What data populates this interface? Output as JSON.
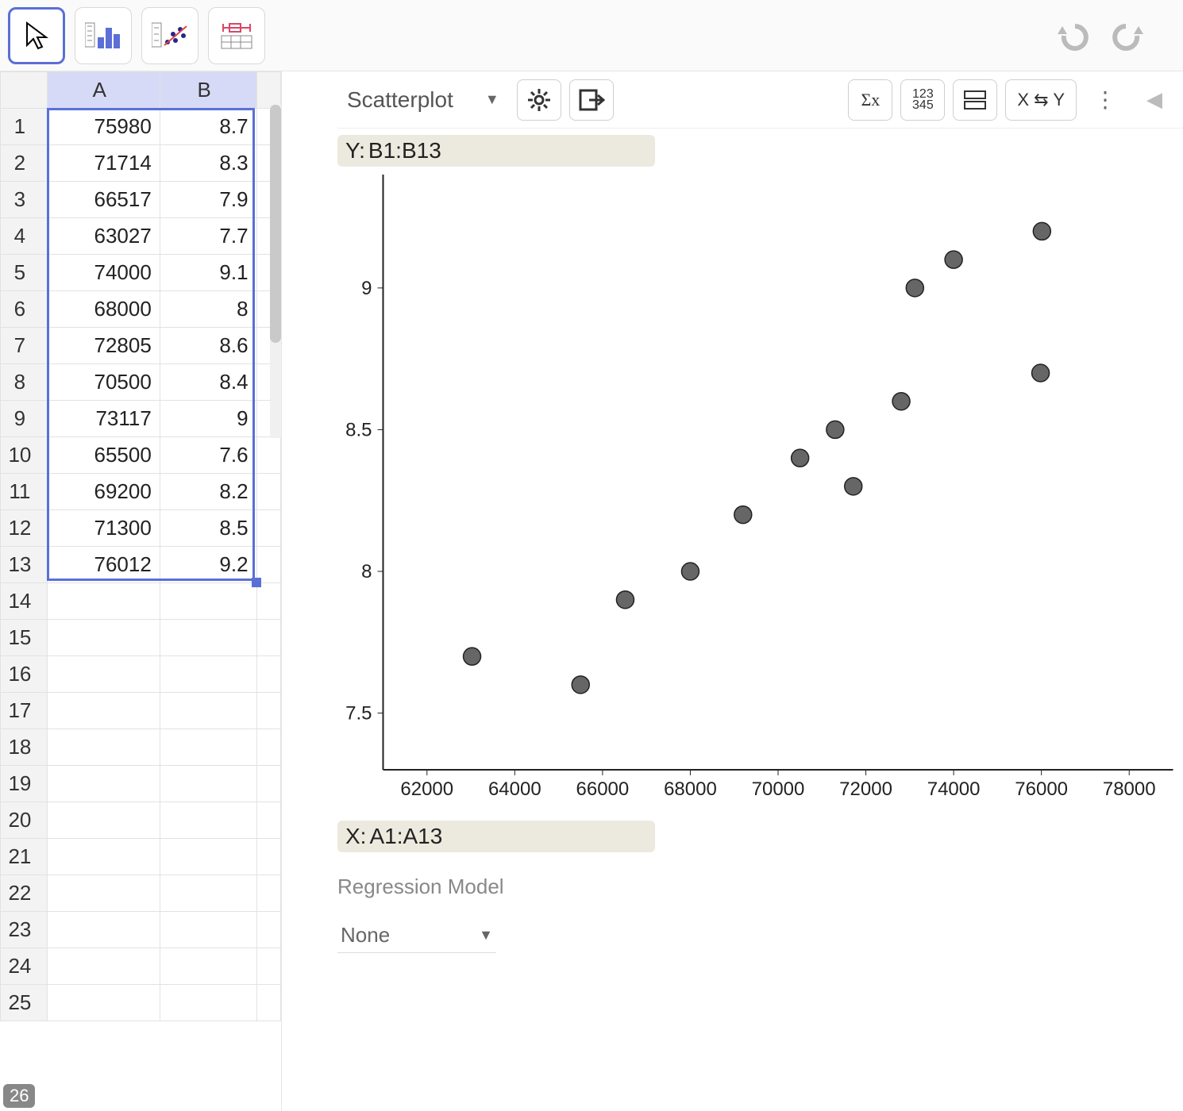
{
  "toolbar": {
    "tool1": "pointer",
    "tool2": "one-variable",
    "tool3": "two-variable",
    "tool4": "boxplot"
  },
  "spreadsheet": {
    "colA": "A",
    "colB": "B",
    "rows": [
      {
        "n": "1",
        "a": "75980",
        "b": "8.7"
      },
      {
        "n": "2",
        "a": "71714",
        "b": "8.3"
      },
      {
        "n": "3",
        "a": "66517",
        "b": "7.9"
      },
      {
        "n": "4",
        "a": "63027",
        "b": "7.7"
      },
      {
        "n": "5",
        "a": "74000",
        "b": "9.1"
      },
      {
        "n": "6",
        "a": "68000",
        "b": "8"
      },
      {
        "n": "7",
        "a": "72805",
        "b": "8.6"
      },
      {
        "n": "8",
        "a": "70500",
        "b": "8.4"
      },
      {
        "n": "9",
        "a": "73117",
        "b": "9"
      },
      {
        "n": "10",
        "a": "65500",
        "b": "7.6"
      },
      {
        "n": "11",
        "a": "69200",
        "b": "8.2"
      },
      {
        "n": "12",
        "a": "71300",
        "b": "8.5"
      },
      {
        "n": "13",
        "a": "76012",
        "b": "9.2"
      }
    ],
    "empty_rows": [
      "14",
      "15",
      "16",
      "17",
      "18",
      "19",
      "20",
      "21",
      "22",
      "23",
      "24",
      "25"
    ],
    "corner_row": "26"
  },
  "analysis": {
    "type_label": "Scatterplot",
    "swap_label": "X ⇆ Y",
    "y_prefix": "Y:",
    "y_range": "B1:B13",
    "x_prefix": "X:",
    "x_range": "A1:A13"
  },
  "regression": {
    "title": "Regression Model",
    "selected": "None"
  },
  "chart_data": {
    "type": "scatter",
    "xlabel": "",
    "ylabel": "",
    "xlim": [
      61000,
      79000
    ],
    "ylim": [
      7.3,
      9.4
    ],
    "x_ticks": [
      62000,
      64000,
      66000,
      68000,
      70000,
      72000,
      74000,
      76000,
      78000
    ],
    "y_ticks": [
      7.5,
      8,
      8.5,
      9
    ],
    "points": [
      {
        "x": 75980,
        "y": 8.7
      },
      {
        "x": 71714,
        "y": 8.3
      },
      {
        "x": 66517,
        "y": 7.9
      },
      {
        "x": 63027,
        "y": 7.7
      },
      {
        "x": 74000,
        "y": 9.1
      },
      {
        "x": 68000,
        "y": 8.0
      },
      {
        "x": 72805,
        "y": 8.6
      },
      {
        "x": 70500,
        "y": 8.4
      },
      {
        "x": 73117,
        "y": 9.0
      },
      {
        "x": 65500,
        "y": 7.6
      },
      {
        "x": 69200,
        "y": 8.2
      },
      {
        "x": 71300,
        "y": 8.5
      },
      {
        "x": 76012,
        "y": 9.2
      }
    ]
  }
}
